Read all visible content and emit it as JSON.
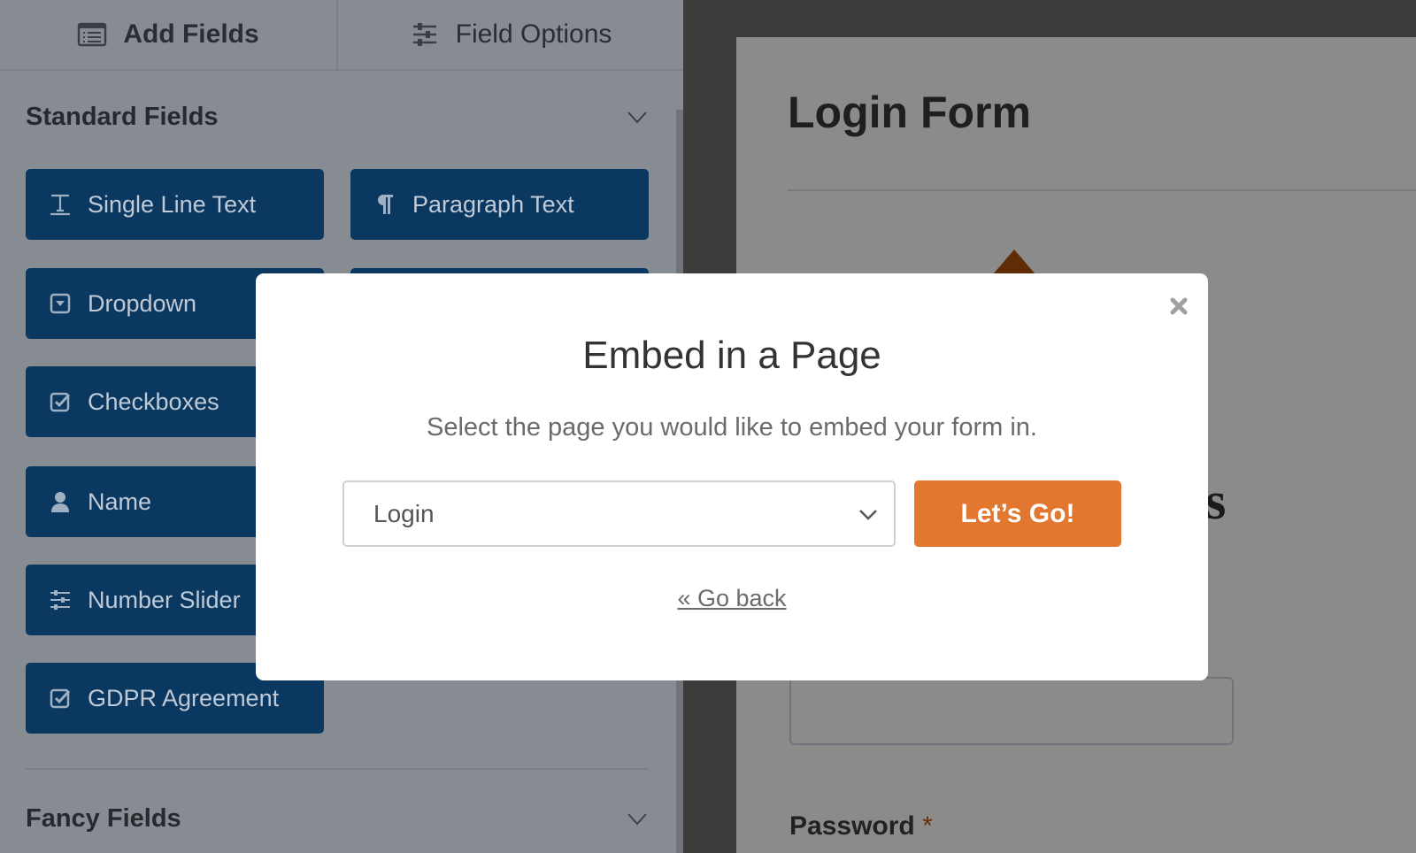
{
  "tabs": [
    {
      "label": "Add Fields",
      "icon": "list-icon"
    },
    {
      "label": "Field Options",
      "icon": "sliders-icon"
    }
  ],
  "sections": {
    "standard": "Standard Fields",
    "fancy": "Fancy Fields"
  },
  "fields": [
    {
      "label": "Single Line Text",
      "icon": "text-icon"
    },
    {
      "label": "Paragraph Text",
      "icon": "paragraph-icon"
    },
    {
      "label": "Dropdown",
      "icon": "dropdown-icon"
    },
    {
      "label": "Checkboxes",
      "icon": "checkbox-icon"
    },
    {
      "label": "Name",
      "icon": "user-icon"
    },
    {
      "label": "Number Slider",
      "icon": "sliders-icon"
    },
    {
      "label": "GDPR Agreement",
      "icon": "checkbox-icon"
    }
  ],
  "preview": {
    "title": "Login Form",
    "partial_text": "s",
    "password_label": "Password",
    "required_mark": "*"
  },
  "modal": {
    "title": "Embed in a Page",
    "subtitle": "Select the page you would like to embed your form in.",
    "select_value": "Login",
    "submit_label": "Let’s Go!",
    "back_label": "« Go back"
  },
  "colors": {
    "field_button": "#0b3860",
    "accent": "#e27730",
    "overlay_dim": "#878c93"
  }
}
